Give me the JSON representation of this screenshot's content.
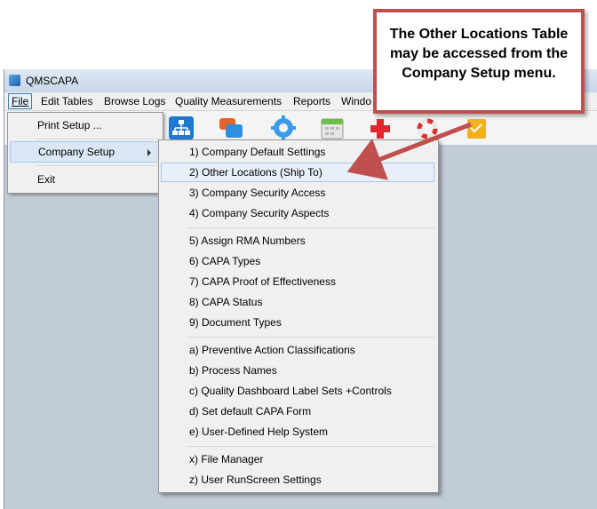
{
  "window": {
    "title": "QMSCAPA"
  },
  "menubar": {
    "items": [
      "File",
      "Edit Tables",
      "Browse Logs",
      "Quality Measurements",
      "Reports",
      "Windo"
    ]
  },
  "file_menu": {
    "items": [
      "Print Setup ...",
      "Company Setup",
      "Exit"
    ]
  },
  "submenu": {
    "items": [
      "1) Company Default Settings",
      "2) Other Locations (Ship To)",
      "3) Company Security Access",
      "4) Company Security Aspects",
      "5) Assign RMA Numbers",
      "6) CAPA Types",
      "7) CAPA Proof of Effectiveness",
      "8) CAPA Status",
      "9) Document Types",
      "a) Preventive Action Classifications",
      "b) Process Names",
      "c) Quality Dashboard Label Sets +Controls",
      "d) Set default CAPA Form",
      "e) User-Defined Help System",
      "x) File Manager",
      "z) User RunScreen Settings"
    ]
  },
  "callout": {
    "text": "The Other Locations Table may be accessed from the Company Setup menu."
  },
  "colors": {
    "callout_border": "#c0504d",
    "arrow": "#c0504d"
  },
  "icons": [
    "app-icon",
    "org-chart-icon",
    "chat-icon",
    "gear-icon",
    "calendar-icon",
    "red-cross-icon",
    "lifebuoy-icon",
    "notepad-icon"
  ]
}
